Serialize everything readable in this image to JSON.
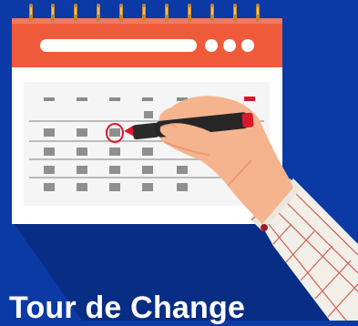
{
  "banner": {
    "title": "Tour de Change"
  },
  "calendar": {
    "rings": 12,
    "header_color": "#ef5a3a",
    "page_color": "#ffffff",
    "weekday_marker_color": "#8b8b8b",
    "weekend_marker_color": "#d9182b",
    "cell_color": "#8f8f8f",
    "circle_color": "#d9182b"
  },
  "illustration": {
    "background_color": "#0b3aa6",
    "marker_color": "#262626",
    "marker_tip_color": "#d9182b",
    "skin_color": "#f6b48e",
    "shirt_color": "#f2efe9",
    "shirt_check_color": "#c9473c"
  }
}
